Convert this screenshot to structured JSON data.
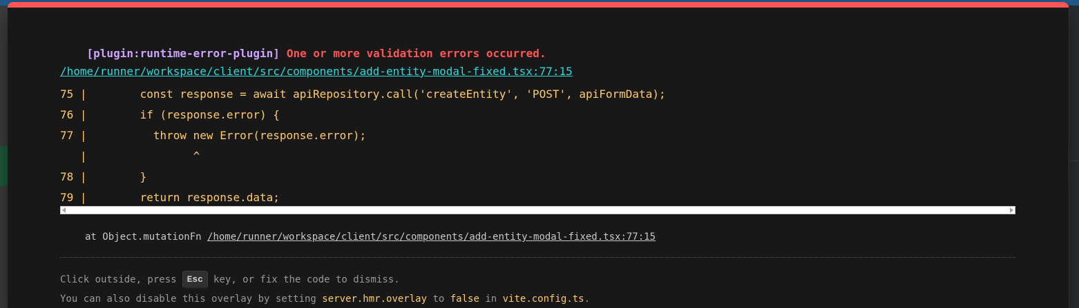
{
  "error": {
    "plugin": "[plugin:runtime-error-plugin]",
    "message": "One or more validation errors occurred.",
    "file": "/home/runner/workspace/client/src/components/add-entity-modal-fixed.tsx:77:15"
  },
  "frame": {
    "lines": [
      "75 |        const response = await apiRepository.call('createEntity', 'POST', apiFormData);",
      "76 |        if (response.error) {",
      "77 |          throw new Error(response.error);",
      "   |                ^",
      "78 |        }",
      "79 |        return response.data;"
    ]
  },
  "stack": {
    "prefix": "at Object.mutationFn ",
    "link": "/home/runner/workspace/client/src/components/add-entity-modal-fixed.tsx:77:15"
  },
  "tip": {
    "line1_before": "Click outside, press",
    "key": "Esc",
    "line1_after": "key, or fix the code to dismiss.",
    "line2_a": "You can also disable this overlay by setting ",
    "line2_code1": "server.hmr.overlay",
    "line2_b": " to ",
    "line2_code2": "false",
    "line2_c": " in ",
    "line2_code3": "vite.config.ts",
    "line2_d": "."
  },
  "colors": {
    "border": "#ff5555",
    "plugin": "#cfa4ff",
    "link": "#2dd9da",
    "code": "#ffcb6b"
  }
}
